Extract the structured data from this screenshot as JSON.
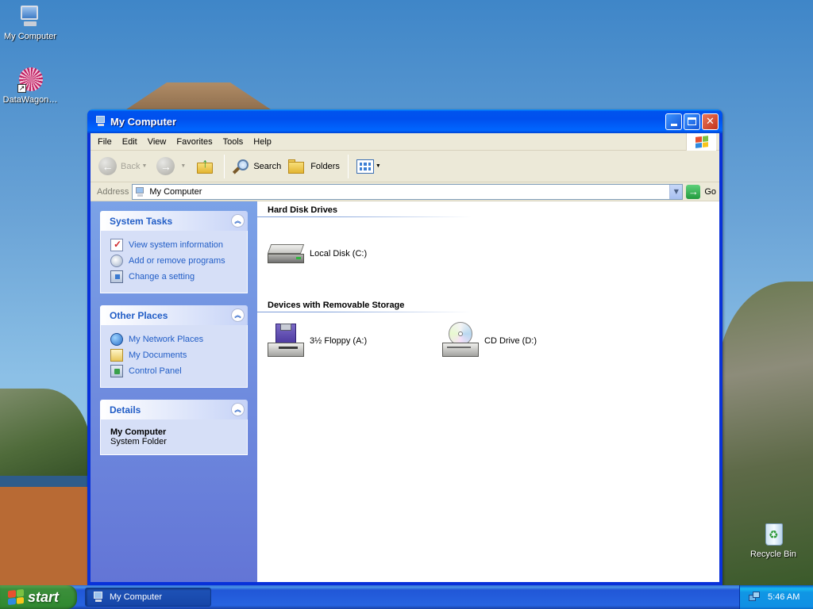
{
  "desktop": {
    "icons": [
      {
        "label": "My Computer"
      },
      {
        "label": "DataWagon…"
      },
      {
        "label": "Recycle Bin"
      }
    ]
  },
  "window": {
    "title": "My Computer",
    "menu": [
      "File",
      "Edit",
      "View",
      "Favorites",
      "Tools",
      "Help"
    ],
    "toolbar": {
      "back": "Back",
      "search": "Search",
      "folders": "Folders"
    },
    "address": {
      "label": "Address",
      "value": "My Computer",
      "go": "Go"
    },
    "taskpane": {
      "system_tasks": {
        "title": "System Tasks",
        "items": [
          "View system information",
          "Add or remove programs",
          "Change a setting"
        ]
      },
      "other_places": {
        "title": "Other Places",
        "items": [
          "My Network Places",
          "My Documents",
          "Control Panel"
        ]
      },
      "details": {
        "title": "Details",
        "name": "My Computer",
        "type": "System Folder"
      }
    },
    "groups": {
      "hard_disks": {
        "title": "Hard Disk Drives",
        "items": [
          "Local Disk (C:)"
        ]
      },
      "removable": {
        "title": "Devices with Removable Storage",
        "items": [
          "3½ Floppy (A:)",
          "CD Drive (D:)"
        ]
      }
    }
  },
  "taskbar": {
    "start": "start",
    "task": "My Computer",
    "clock": "5:46 AM"
  },
  "colors": {
    "titlebar": "#0053ee",
    "start_button": "#318a31",
    "taskpane_link": "#215dc6",
    "taskbar": "#2663e0"
  }
}
